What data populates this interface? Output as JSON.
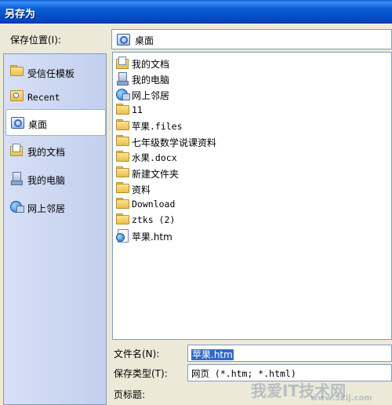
{
  "dialog": {
    "title": "另存为"
  },
  "save_in": {
    "label": "保存位置(I):",
    "value": "桌面",
    "icon": "desktop-icon"
  },
  "places_bar": [
    {
      "label": "受信任模板",
      "icon": "folder-icon"
    },
    {
      "label": "Recent",
      "icon": "recent-icon"
    },
    {
      "label": "桌面",
      "icon": "desktop-icon",
      "selected": true
    },
    {
      "label": "我的文档",
      "icon": "my-documents-icon"
    },
    {
      "label": "我的电脑",
      "icon": "my-computer-icon"
    },
    {
      "label": "网上邻居",
      "icon": "network-places-icon"
    }
  ],
  "files": [
    {
      "name": "我的文档",
      "icon": "my-documents-icon"
    },
    {
      "name": "我的电脑",
      "icon": "my-computer-icon"
    },
    {
      "name": "网上邻居",
      "icon": "network-places-icon"
    },
    {
      "name": "11",
      "icon": "folder-icon"
    },
    {
      "name": "苹果.files",
      "icon": "folder-icon"
    },
    {
      "name": "七年级数学说课资料",
      "icon": "folder-icon"
    },
    {
      "name": "水果.docx",
      "icon": "folder-icon"
    },
    {
      "name": "新建文件夹",
      "icon": "folder-icon"
    },
    {
      "name": "资料",
      "icon": "folder-icon"
    },
    {
      "name": "Download",
      "icon": "folder-icon"
    },
    {
      "name": "ztks (2)",
      "icon": "folder-icon"
    },
    {
      "name": "苹果.htm",
      "icon": "htm-file-icon"
    }
  ],
  "fields": {
    "filename_label": "文件名(N):",
    "filename_value": "苹果.htm",
    "type_label": "保存类型(T):",
    "type_value": "网页 (*.htm; *.html)",
    "page_title_label": "页标题:"
  },
  "watermark": {
    "text": "www.52ij.com",
    "brand": "我爱IT技术网"
  }
}
